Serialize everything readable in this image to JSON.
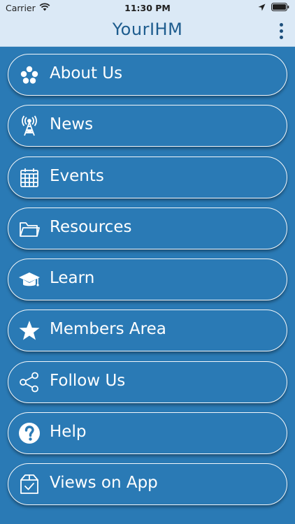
{
  "status_bar": {
    "carrier": "Carrier",
    "time": "11:30 PM"
  },
  "header": {
    "title": "YourIHM"
  },
  "menu": {
    "items": [
      {
        "label": "About Us",
        "icon": "dots-cluster-icon"
      },
      {
        "label": "News",
        "icon": "radio-tower-icon"
      },
      {
        "label": "Events",
        "icon": "calendar-icon"
      },
      {
        "label": "Resources",
        "icon": "folder-icon"
      },
      {
        "label": "Learn",
        "icon": "graduation-cap-icon"
      },
      {
        "label": "Members Area",
        "icon": "star-icon"
      },
      {
        "label": "Follow Us",
        "icon": "share-icon"
      },
      {
        "label": "Help",
        "icon": "help-icon"
      },
      {
        "label": "Views on App",
        "icon": "feedback-box-icon"
      }
    ]
  },
  "colors": {
    "background": "#2a7ab5",
    "header": "#dbe9f6",
    "title": "#1d5c8e",
    "button_border": "#f3f8fc"
  }
}
